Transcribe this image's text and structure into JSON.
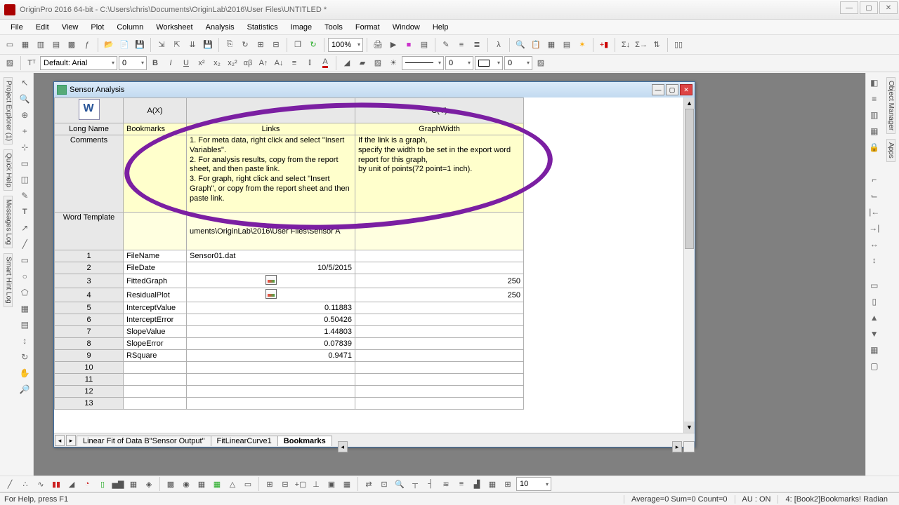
{
  "app": {
    "title": "OriginPro 2016 64-bit - C:\\Users\\chris\\Documents\\OriginLab\\2016\\User Files\\UNTITLED *"
  },
  "menu": [
    "File",
    "Edit",
    "View",
    "Plot",
    "Column",
    "Worksheet",
    "Analysis",
    "Statistics",
    "Image",
    "Tools",
    "Format",
    "Window",
    "Help"
  ],
  "toolbar": {
    "zoom": "100%"
  },
  "format": {
    "font": "Default: Arial",
    "size": "0",
    "linewidth": "0",
    "markersize": "0"
  },
  "childwin": {
    "title": "Sensor Analysis"
  },
  "columns": {
    "row": "",
    "a": "A(X)",
    "b": "",
    "c": "C(Y)"
  },
  "labels": {
    "longname": "Long Name",
    "comments": "Comments",
    "wordtemplate": "Word Template"
  },
  "longname": {
    "a": "Bookmarks",
    "b": "Links",
    "c": "GraphWidth"
  },
  "comments": {
    "b": "1. For meta data, right click and select \"Insert Variables\".\n2. For analysis results, copy from the report sheet, and then paste link.\n3. For graph, right click and select \"Insert Graph\", or copy from the report sheet and then paste link.",
    "c": "If the link is a graph,\nspecify the width to be set in the export word report for this graph,\nby unit of points(72 point=1 inch)."
  },
  "wordtemplate": {
    "b": "uments\\OriginLab\\2016\\User Files\\Sensor A"
  },
  "rows": [
    {
      "n": "1",
      "a": "FileName",
      "b": "Sensor01.dat",
      "c": ""
    },
    {
      "n": "2",
      "a": "FileDate",
      "b": "10/5/2015",
      "c": "",
      "balign": "right"
    },
    {
      "n": "3",
      "a": "FittedGraph",
      "b": "[graph]",
      "c": "250",
      "calign": "right"
    },
    {
      "n": "4",
      "a": "ResidualPlot",
      "b": "[graph]",
      "c": "250",
      "calign": "right"
    },
    {
      "n": "5",
      "a": "InterceptValue",
      "b": "0.11883",
      "c": "",
      "balign": "right"
    },
    {
      "n": "6",
      "a": "InterceptError",
      "b": "0.50426",
      "c": "",
      "balign": "right"
    },
    {
      "n": "7",
      "a": "SlopeValue",
      "b": "1.44803",
      "c": "",
      "balign": "right"
    },
    {
      "n": "8",
      "a": "SlopeError",
      "b": "0.07839",
      "c": "",
      "balign": "right"
    },
    {
      "n": "9",
      "a": "RSquare",
      "b": "0.9471",
      "c": "",
      "balign": "right"
    },
    {
      "n": "10",
      "a": "",
      "b": "",
      "c": ""
    },
    {
      "n": "11",
      "a": "",
      "b": "",
      "c": ""
    },
    {
      "n": "12",
      "a": "",
      "b": "",
      "c": ""
    },
    {
      "n": "13",
      "a": "",
      "b": "",
      "c": ""
    }
  ],
  "tabs": {
    "t1": "Linear Fit of Data B\"Sensor Output\"",
    "t2": "FitLinearCurve1",
    "t3": "Bookmarks"
  },
  "status": {
    "help": "For Help, press F1",
    "avg": "Average=0 Sum=0 Count=0",
    "au": "AU : ON",
    "pos": "4: [Book2]Bookmarks!  Radian"
  },
  "bottomcombo": "10"
}
